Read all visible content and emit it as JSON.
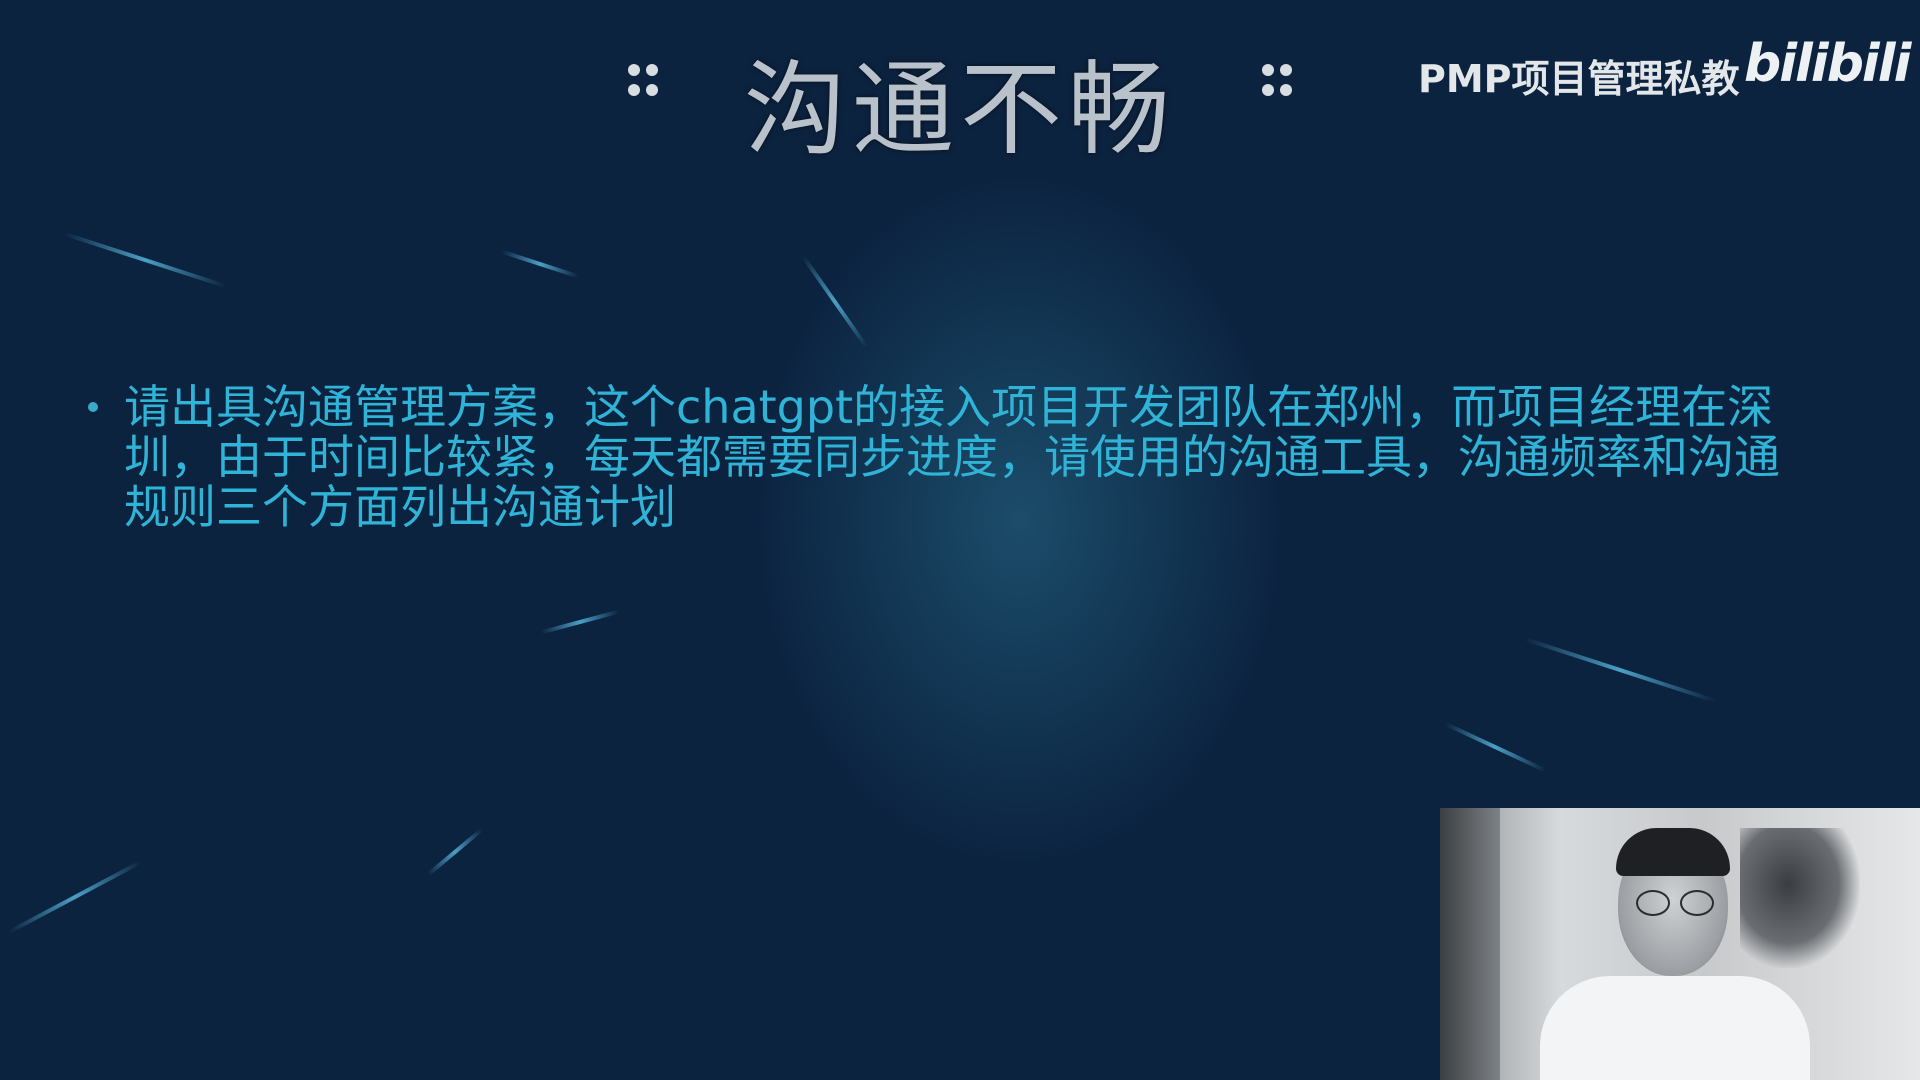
{
  "slide": {
    "title": "沟通不畅",
    "bullet_text": "请出具沟通管理方案，这个chatgpt的接入项目开发团队在郑州，而项目经理在深圳，由于时间比较紧，每天都需要同步进度，请使用的沟通工具，沟通频率和沟通规则三个方面列出沟通计划"
  },
  "branding": {
    "channel_label": "PMP项目管理私教",
    "logo_text": "bilibili"
  },
  "colors": {
    "background": "#0c2340",
    "bullet_text": "#2fb3d6",
    "title": "#b9c2cb"
  }
}
